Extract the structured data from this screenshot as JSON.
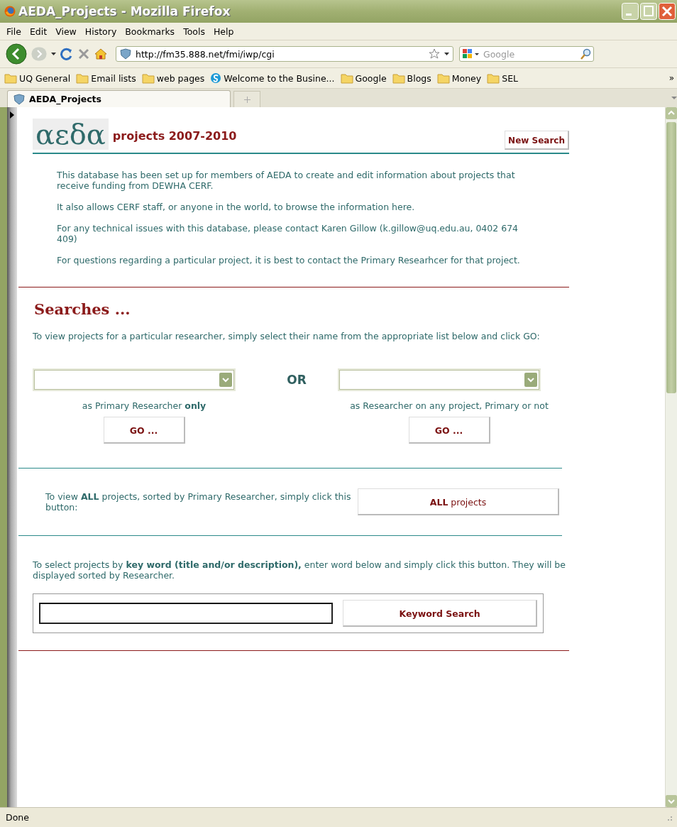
{
  "window": {
    "title": "AEDA_Projects - Mozilla Firefox"
  },
  "menu": [
    "File",
    "Edit",
    "View",
    "History",
    "Bookmarks",
    "Tools",
    "Help"
  ],
  "navbar": {
    "url": "http://fm35.888.net/fmi/iwp/cgi",
    "search_placeholder": "Google"
  },
  "bookmarks": [
    {
      "label": "UQ General",
      "kind": "folder"
    },
    {
      "label": "Email lists",
      "kind": "folder"
    },
    {
      "label": "web pages",
      "kind": "folder"
    },
    {
      "label": "Welcome to the Busine...",
      "kind": "site"
    },
    {
      "label": "Google",
      "kind": "folder"
    },
    {
      "label": "Blogs",
      "kind": "folder"
    },
    {
      "label": "Money",
      "kind": "folder"
    },
    {
      "label": "SEL",
      "kind": "folder"
    }
  ],
  "bookmarks_overflow": "»",
  "tabs": [
    {
      "label": "AEDA_Projects",
      "selected": true
    }
  ],
  "page": {
    "logo": "αεδα",
    "heading": "projects 2007-2010",
    "new_search": "New Search",
    "intro": [
      "This database has been set up for members of AEDA to create and edit information about projects that receive funding from DEWHA CERF.",
      "It also allows CERF staff, or anyone in the world, to browse the information here.",
      "For any technical issues with this database, please contact Karen Gillow (k.gillow@uq.edu.au, 0402 674 409)",
      "For questions regarding a particular project, it is best to contact the Primary Researhcer for that project."
    ],
    "searches_title": "Searches ...",
    "researcher_instructions": "To view projects for a particular researcher, simply select their name from the appropriate list below and click GO:",
    "or": "OR",
    "selects": [
      {
        "caption": "as Primary Researcher **only**",
        "button": "GO ..."
      },
      {
        "caption": "as Researcher on any project, Primary or not",
        "button": "GO ..."
      }
    ],
    "all": {
      "text": "To view **ALL** projects, sorted by Primary Researcher, simply click this button:",
      "button": "**ALL** projects"
    },
    "keyword": {
      "text": "To select projects by **key word (title and/or description),** enter word below and simply click this button. They will be displayed sorted by Researcher.",
      "button": "Keyword Search"
    }
  },
  "status_bar": "Done"
}
